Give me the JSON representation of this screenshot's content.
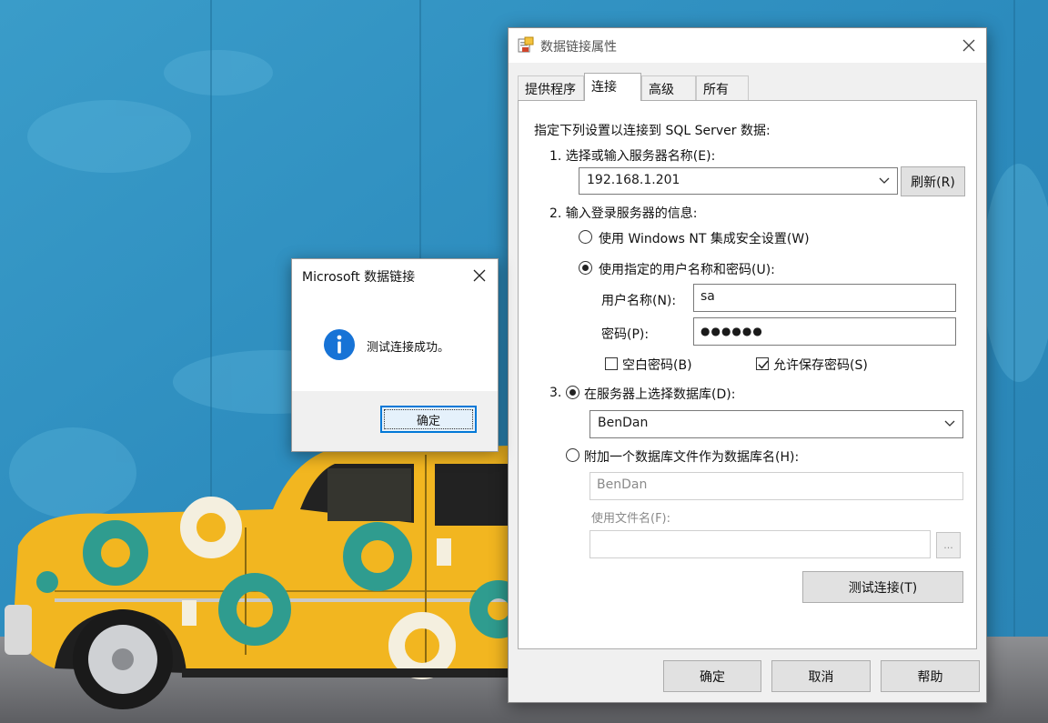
{
  "dialog": {
    "title": "数据链接属性",
    "tabs": [
      "提供程序",
      "连接",
      "高级",
      "所有"
    ],
    "active_tab": "连接",
    "intro": "指定下列设置以连接到 SQL Server 数据:",
    "step1_label": "1. 选择或输入服务器名称(E):",
    "server_value": "192.168.1.201",
    "refresh_button": "刷新(R)",
    "step2_label": "2. 输入登录服务器的信息:",
    "radio_windows_nt": "使用 Windows NT 集成安全设置(W)",
    "radio_specific_user": "使用指定的用户名称和密码(U):",
    "username_label": "用户名称(N):",
    "username_value": "sa",
    "password_label": "密码(P):",
    "password_value": "●●●●●●",
    "blank_password_label": "空白密码(B)",
    "blank_password_checked": false,
    "allow_save_password_label": "允许保存密码(S)",
    "allow_save_password_checked": true,
    "step3_prefix": "3.",
    "radio_select_db": "在服务器上选择数据库(D):",
    "database_value": "BenDan",
    "radio_attach_db": "附加一个数据库文件作为数据库名(H):",
    "attach_db_value": "BenDan",
    "use_filename_label": "使用文件名(F):",
    "use_filename_value": "",
    "browse_button": "...",
    "test_connection_button": "测试连接(T)",
    "ok_button": "确定",
    "cancel_button": "取消",
    "help_button": "帮助"
  },
  "message_box": {
    "title": "Microsoft 数据链接",
    "text": "测试连接成功。",
    "ok_button": "确定"
  },
  "colors": {
    "wall_blue": "#2f8fc0",
    "car_yellow": "#f2b620",
    "ring_teal": "#2f9c8f",
    "info_blue": "#1773d6",
    "focus_blue": "#0078d7"
  },
  "icons": [
    "data-link-app-icon",
    "close-icon",
    "chevron-down-icon",
    "information-icon",
    "checkmark-icon"
  ]
}
